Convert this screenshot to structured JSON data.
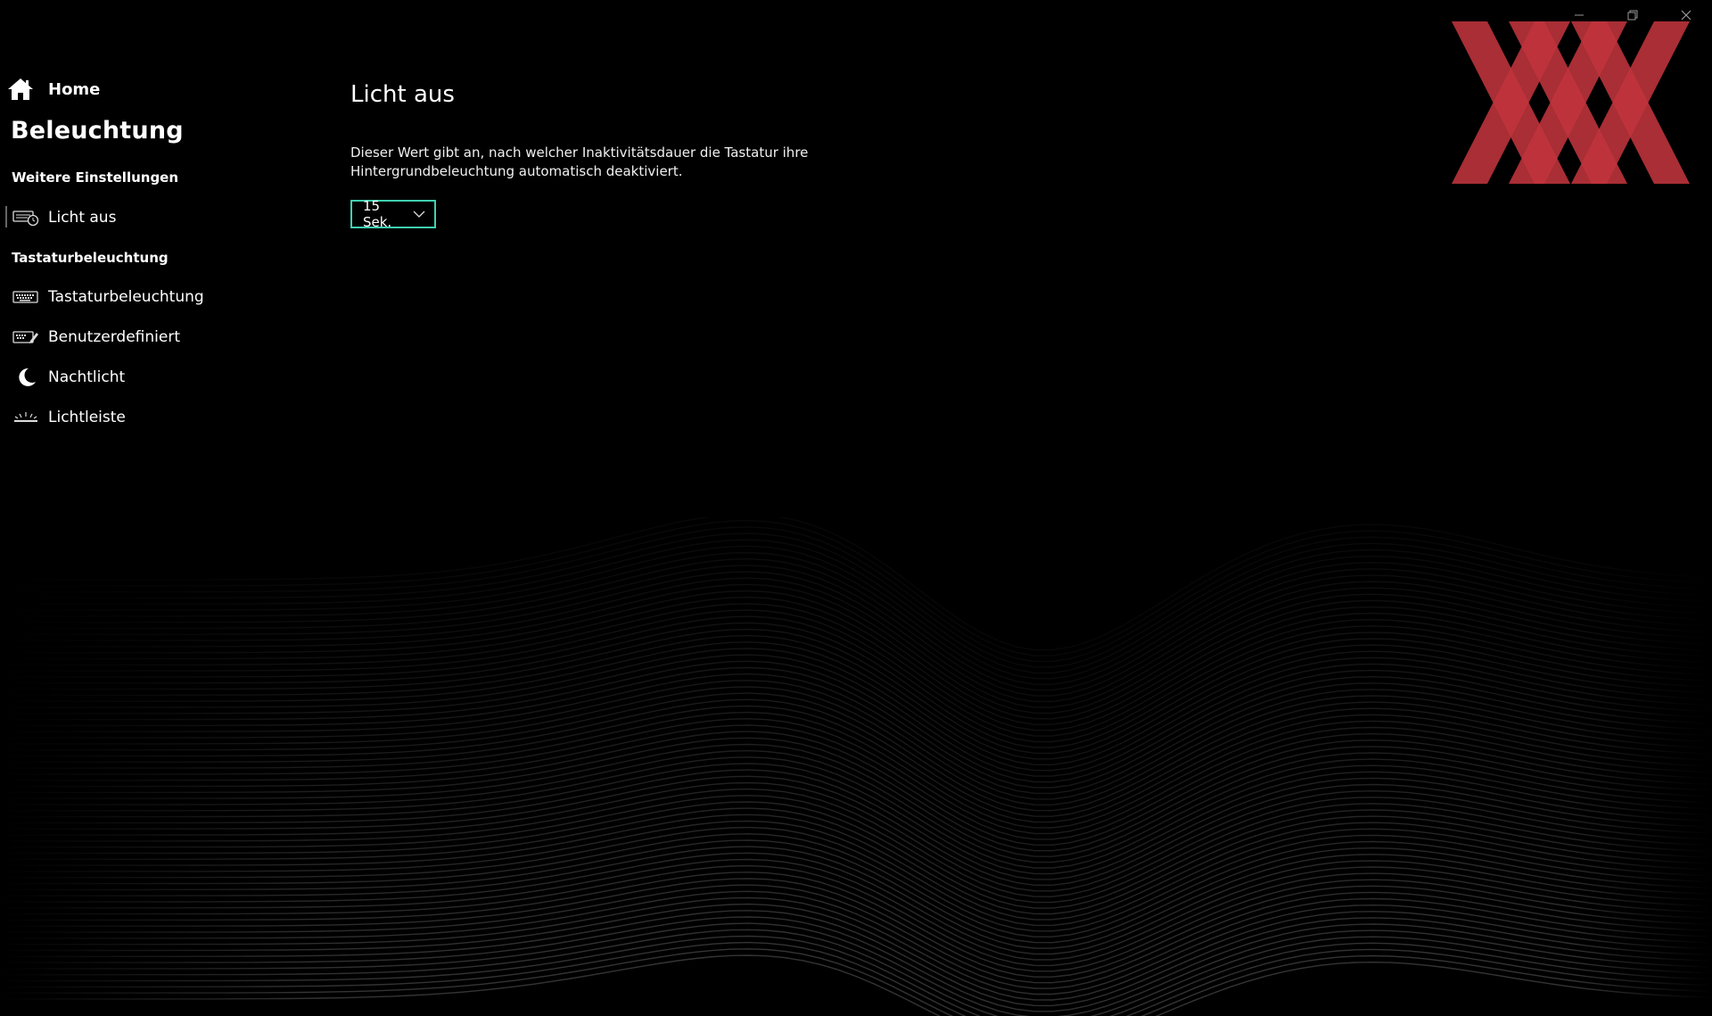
{
  "window": {
    "controls": [
      "minimize",
      "restore",
      "close"
    ]
  },
  "sidebar": {
    "home_label": "Home",
    "section_title": "Beleuchtung",
    "groups": [
      {
        "header": "Weitere Einstellungen",
        "items": [
          {
            "label": "Licht aus",
            "icon": "keyboard-timer-icon",
            "active": true
          }
        ]
      },
      {
        "header": "Tastaturbeleuchtung",
        "items": [
          {
            "label": "Tastaturbeleuchtung",
            "icon": "keyboard-icon"
          },
          {
            "label": "Benutzerdefiniert",
            "icon": "keyboard-edit-icon"
          },
          {
            "label": "Nachtlicht",
            "icon": "moon-icon"
          },
          {
            "label": "Lichtleiste",
            "icon": "light-bar-icon"
          }
        ]
      }
    ]
  },
  "main": {
    "title": "Licht aus",
    "description": "Dieser Wert gibt an, nach welcher Inaktivitätsdauer die Tastatur ihre Hintergrundbeleuchtung automatisch deaktiviert.",
    "timeout_select": {
      "value": "15 Sek."
    }
  },
  "colors": {
    "background": "#000000",
    "accent": "#3fd0b0",
    "logo_red": "#c0343c"
  }
}
